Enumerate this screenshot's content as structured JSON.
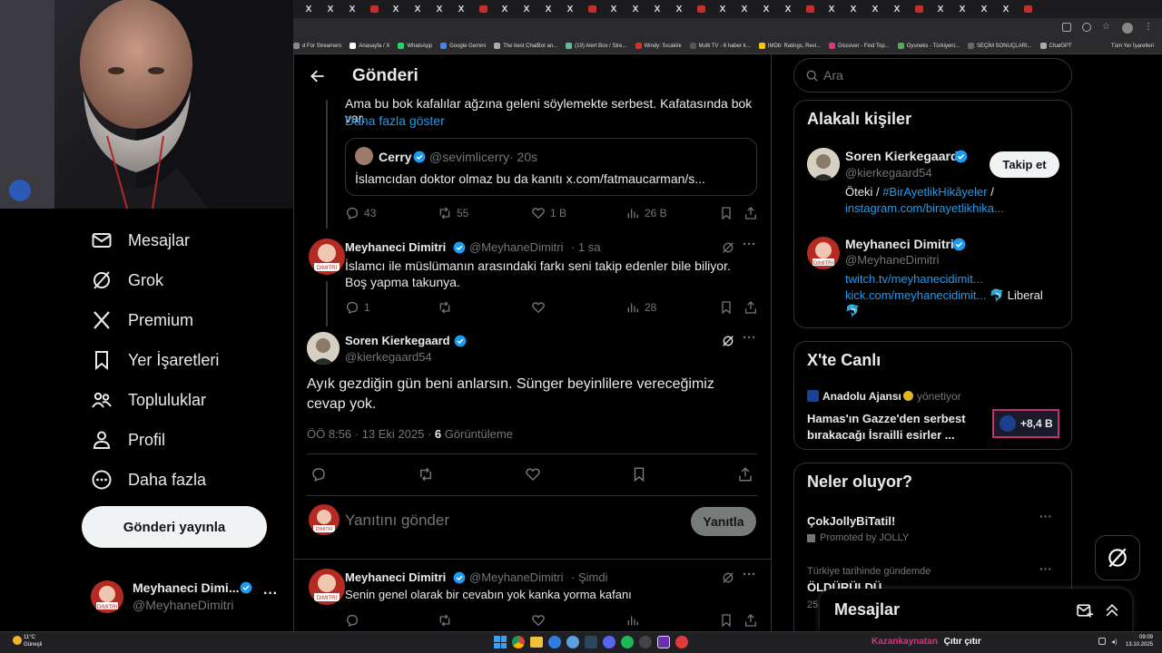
{
  "browser": {
    "tabs": [
      "X",
      "X",
      "X",
      "X",
      "X",
      "X",
      "X",
      "X",
      "X",
      "X",
      "X",
      "X",
      "X",
      "X",
      "X",
      "X",
      "X",
      "X",
      "X",
      "X",
      "X",
      "X",
      "X",
      "X",
      "X",
      "X",
      "X",
      "X",
      "X",
      "X",
      "X",
      "X",
      "X",
      "X"
    ],
    "bookmarks": [
      "d For Streamers",
      "Anasayfa / X",
      "WhatsApp",
      "Google Gemini",
      "The best ChatBot an...",
      "(19) Alert Box / Stre...",
      "Windy: Sıcaklık",
      "Multi TV - 6 haber k...",
      "IMDb: Ratings, Revi...",
      "Discover - Find Top...",
      "Oyuneks - Türkiyeni...",
      "SEÇİM SONUÇLARI...",
      "ChatGPT"
    ],
    "bookmarks_all": "Tüm Yer İşaretleri"
  },
  "nav": {
    "items": [
      {
        "label": "Mesajlar",
        "icon": "envelope-icon"
      },
      {
        "label": "Grok",
        "icon": "grok-icon"
      },
      {
        "label": "Premium",
        "icon": "x-logo-icon"
      },
      {
        "label": "Yer İşaretleri",
        "icon": "bookmark-icon"
      },
      {
        "label": "Topluluklar",
        "icon": "people-icon"
      },
      {
        "label": "Profil",
        "icon": "person-icon"
      },
      {
        "label": "Daha fazla",
        "icon": "more-circle-icon"
      }
    ],
    "post_button": "Gönderi yayınla",
    "account": {
      "name": "Meyhaneci Dimi...",
      "handle": "@MeyhaneDimitri"
    }
  },
  "header": {
    "title": "Gönderi"
  },
  "thread": {
    "top_text": "Ama bu bok kafalılar ağzına geleni söylemekte serbest. Kafatasında bok var.",
    "show_more": "Daha fazla göster",
    "quote": {
      "name": "Cerry",
      "handle": "@sevimlicerry",
      "time": "· 20s",
      "text": "İslamcıdan doktor olmaz bu da kanıtı x.com/fatmaucarman/s..."
    },
    "top_actions": {
      "replies": "43",
      "reposts": "55",
      "likes": "1 B",
      "views": "26 B"
    },
    "reply1": {
      "name": "Meyhaneci Dimitri",
      "handle": "@MeyhaneDimitri",
      "time": "· 1 sa",
      "text": "İslamcı ile müslümanın arasındaki farkı seni takip edenler bile biliyor. Boş yapma takunya.",
      "replies": "1",
      "views": "28"
    },
    "main": {
      "name": "Soren Kierkegaard",
      "handle": "@kierkegaard54",
      "text": "Ayık gezdiğin gün beni anlarsın. Sünger beyinlilere vereceğimiz cevap yok.",
      "meta": "ÖÖ 8:56 · 13 Eki 2025 ·",
      "views": "6",
      "views_label": "Görüntüleme"
    },
    "reply_box": {
      "placeholder": "Yanıtını gönder",
      "button": "Yanıtla"
    },
    "reply2": {
      "name": "Meyhaneci Dimitri",
      "handle": "@MeyhaneDimitri",
      "time": "· Şimdi",
      "text": "Senin genel olarak bir cevabın yok kanka yorma kafanı"
    }
  },
  "right": {
    "search_placeholder": "Ara",
    "related_title": "Alakalı kişiler",
    "p1": {
      "name": "Soren Kierkegaard",
      "handle": "@kierkegaard54",
      "follow": "Takip et",
      "bio_a": "Öteki /",
      "bio_tag": "#BirAyetlikHikâyeler",
      "bio_b": "/",
      "bio_link": "instagram.com/birayetlikhika..."
    },
    "p2": {
      "name": "Meyhaneci Dimitri",
      "handle": "@MeyhaneDimitri",
      "link1": "twitch.tv/meyhanecidimit...",
      "link2": "kick.com/meyhanecidimit...",
      "liberal": "🐬 Liberal",
      "fish": "🐬"
    },
    "live_title": "X'te Canlı",
    "live": {
      "host": "Anadolu Ajansı",
      "host_role": "yönetiyor",
      "text": "Hamas'ın Gazze'den serbest bırakacağı İsrailli esirler ...",
      "count": "+8,4 B"
    },
    "trends_title": "Neler oluyor?",
    "t1": {
      "title": "ÇokJollyBiTatil!",
      "promo": "Promoted by JOLLY"
    },
    "t2": {
      "context": "Türkiye tarihinde gündemde",
      "title": "ÖLDÜRÜLDÜ",
      "count": "25"
    }
  },
  "messages_drawer": {
    "title": "Mesajlar"
  },
  "taskbar": {
    "temp": "11°C",
    "weather": "Güneşli",
    "ticker_a": "Kazankaynatan",
    "ticker_b": "Çıtır çıtır",
    "time": "09:09",
    "date": "13.10.2025"
  },
  "colors": {
    "bg": "#000000",
    "accent": "#1d9bf0",
    "text": "#e7e9ea",
    "muted": "#71767b",
    "border": "#2f3336"
  }
}
